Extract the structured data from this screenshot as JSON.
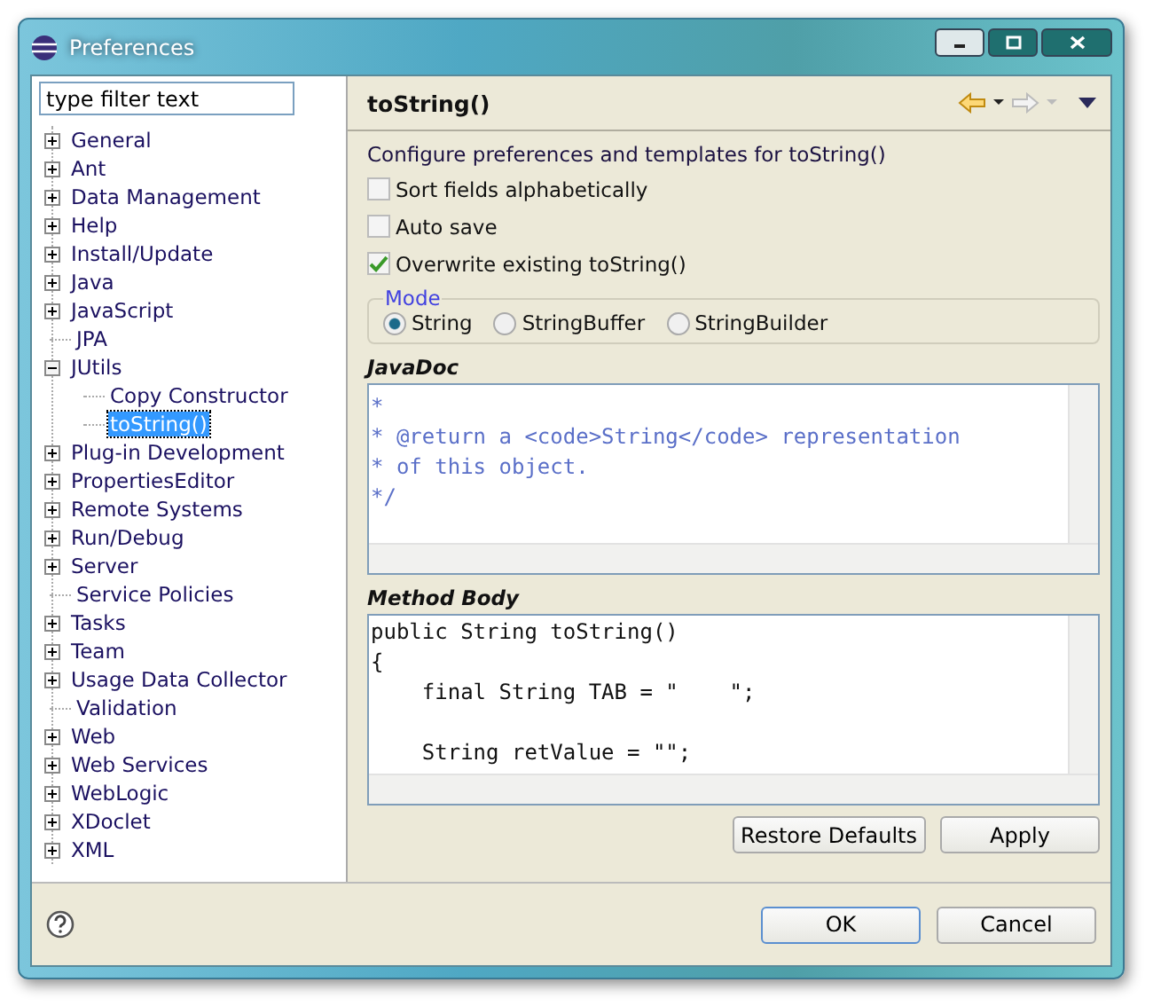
{
  "window": {
    "title": "Preferences"
  },
  "filter": {
    "placeholder": "type filter text"
  },
  "tree": [
    {
      "label": "General",
      "kind": "folder",
      "expanded": false,
      "selected": false
    },
    {
      "label": "Ant",
      "kind": "folder",
      "expanded": false,
      "selected": false
    },
    {
      "label": "Data Management",
      "kind": "folder",
      "expanded": false,
      "selected": false
    },
    {
      "label": "Help",
      "kind": "folder",
      "expanded": false,
      "selected": false
    },
    {
      "label": "Install/Update",
      "kind": "folder",
      "expanded": false,
      "selected": false
    },
    {
      "label": "Java",
      "kind": "folder",
      "expanded": false,
      "selected": false
    },
    {
      "label": "JavaScript",
      "kind": "folder",
      "expanded": false,
      "selected": false
    },
    {
      "label": "JPA",
      "kind": "leaf",
      "selected": false
    },
    {
      "label": "JUtils",
      "kind": "folder",
      "expanded": true,
      "selected": false,
      "children": [
        {
          "label": "Copy Constructor",
          "selected": false
        },
        {
          "label": "toString()",
          "selected": true
        }
      ]
    },
    {
      "label": "Plug-in Development",
      "kind": "folder",
      "expanded": false,
      "selected": false
    },
    {
      "label": "PropertiesEditor",
      "kind": "folder",
      "expanded": false,
      "selected": false
    },
    {
      "label": "Remote Systems",
      "kind": "folder",
      "expanded": false,
      "selected": false
    },
    {
      "label": "Run/Debug",
      "kind": "folder",
      "expanded": false,
      "selected": false
    },
    {
      "label": "Server",
      "kind": "folder",
      "expanded": false,
      "selected": false
    },
    {
      "label": "Service Policies",
      "kind": "leaf",
      "selected": false
    },
    {
      "label": "Tasks",
      "kind": "folder",
      "expanded": false,
      "selected": false
    },
    {
      "label": "Team",
      "kind": "folder",
      "expanded": false,
      "selected": false
    },
    {
      "label": "Usage Data Collector",
      "kind": "folder",
      "expanded": false,
      "selected": false
    },
    {
      "label": "Validation",
      "kind": "leaf",
      "selected": false
    },
    {
      "label": "Web",
      "kind": "folder",
      "expanded": false,
      "selected": false
    },
    {
      "label": "Web Services",
      "kind": "folder",
      "expanded": false,
      "selected": false
    },
    {
      "label": "WebLogic",
      "kind": "folder",
      "expanded": false,
      "selected": false
    },
    {
      "label": "XDoclet",
      "kind": "folder",
      "expanded": false,
      "selected": false
    },
    {
      "label": "XML",
      "kind": "folder",
      "expanded": false,
      "selected": false
    }
  ],
  "page": {
    "title": "toString()",
    "nav": {
      "back_disabled": false,
      "forward_disabled": true
    },
    "description": "Configure preferences and templates for toString()",
    "options": [
      {
        "label": "Sort fields alphabetically",
        "checked": false
      },
      {
        "label": "Auto save",
        "checked": false
      },
      {
        "label": "Overwrite existing toString()",
        "checked": true
      }
    ],
    "mode": {
      "label": "Mode",
      "choices": [
        {
          "label": "String",
          "selected": true
        },
        {
          "label": "StringBuffer",
          "selected": false
        },
        {
          "label": "StringBuilder",
          "selected": false
        }
      ]
    },
    "javadoc": {
      "label": "JavaDoc",
      "lines": [
        "*",
        "* @return a <code>String</code> representation",
        "* of this object.",
        "*/"
      ]
    },
    "method_body": {
      "label": "Method Body",
      "lines": [
        {
          "text": "public String toString()",
          "gap_before": false
        },
        {
          "text": "{",
          "gap_before": false
        },
        {
          "text": "    final String TAB = \"    \";",
          "gap_before": false
        },
        {
          "text": "    String retValue = \"\";",
          "gap_before": true
        }
      ]
    },
    "buttons": [
      "Restore Defaults",
      "Apply"
    ]
  },
  "footer": {
    "buttons": [
      {
        "label": "OK",
        "default": true
      },
      {
        "label": "Cancel",
        "default": false
      }
    ]
  }
}
